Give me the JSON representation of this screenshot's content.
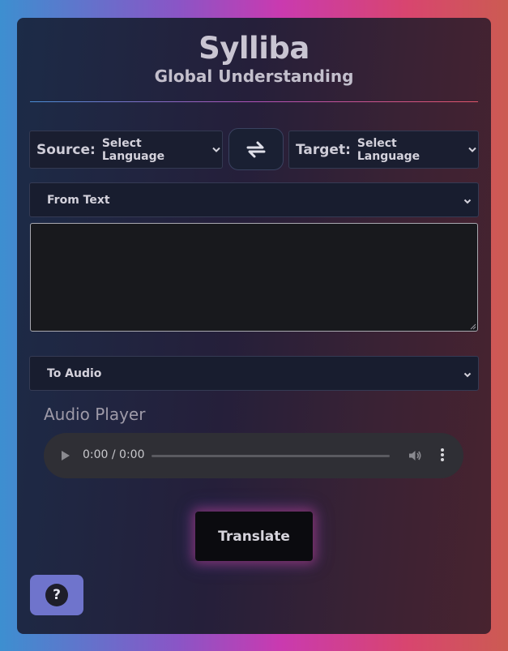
{
  "app": {
    "title": "Sylliba",
    "subtitle": "Global Understanding"
  },
  "languages": {
    "source_label": "Source:",
    "source_value": "Select Language",
    "target_label": "Target:",
    "target_value": "Select Language"
  },
  "input": {
    "mode_value": "From Text",
    "text_value": ""
  },
  "output": {
    "mode_value": "To Audio"
  },
  "audio_player": {
    "title": "Audio Player",
    "time": "0:00 / 0:00"
  },
  "actions": {
    "translate_label": "Translate",
    "help_symbol": "?"
  },
  "icons": {
    "swap": "swap-arrows-icon",
    "chevron": "chevron-down-icon",
    "play": "play-icon",
    "volume": "volume-icon",
    "more": "more-vertical-icon",
    "help": "help-icon"
  },
  "colors": {
    "help_button": "#6f74cc",
    "translate_button": "#0b0b0f"
  }
}
